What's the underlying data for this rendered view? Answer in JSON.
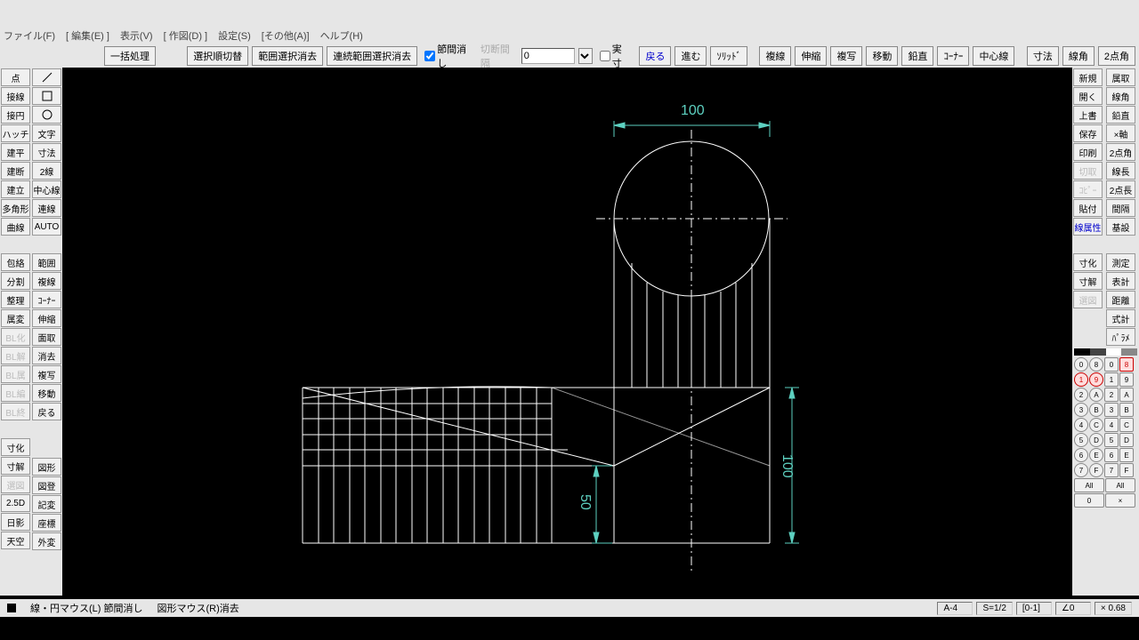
{
  "menu": {
    "file": "ファイル(F)",
    "edit": "[ 編集(E) ]",
    "view": "表示(V)",
    "draw": "[ 作図(D) ]",
    "settings": "設定(S)",
    "other": "[その他(A)]",
    "help": "ヘルプ(H)"
  },
  "toolbar": {
    "batch": "一括処理",
    "sel_order": "選択順切替",
    "range_del": "範囲選択消去",
    "cont_range_del": "連続範囲選択消去",
    "chk1_label": "節間消し",
    "cut_label": "切断間隔",
    "cut_val": "0",
    "chk2_label": "実寸",
    "back": "戻る",
    "fwd": "進む",
    "solid": "ｿﾘｯﾄﾞ",
    "dup_line": "複線",
    "ext": "伸縮",
    "copy": "複写",
    "move": "移動",
    "perp": "鉛直",
    "corner": "ｺｰﾅｰ",
    "center": "中心線",
    "dim": "寸法",
    "angle": "線角",
    "pt2": "2点角"
  },
  "left": {
    "col1": [
      "点",
      "接線",
      "接円",
      "ハッチ",
      "建平",
      "建断",
      "建立",
      "多角形",
      "曲線"
    ],
    "col2": [
      "／",
      "□",
      "○",
      "文字",
      "寸法",
      "2線",
      "中心線",
      "連線",
      "AUTO"
    ],
    "col1b": [
      "包絡",
      "分割",
      "整理",
      "属変",
      "BL化",
      "BL解",
      "BL属",
      "BL編",
      "BL終"
    ],
    "col2b": [
      "範囲",
      "複線",
      "ｺｰﾅｰ",
      "伸縮",
      "面取",
      "消去",
      "複写",
      "移動",
      "戻る"
    ],
    "col1c": [
      "寸化",
      "寸解",
      "選図",
      "2.5D",
      "日影",
      "天空"
    ],
    "col2c": [
      "図形",
      "図登",
      "記変",
      "座標",
      "外変"
    ]
  },
  "right": {
    "col1": [
      "新規",
      "開く",
      "上書",
      "保存",
      "印刷",
      "切取",
      "ｺﾋﾟｰ",
      "貼付",
      "線属性"
    ],
    "col2": [
      "属取",
      "線角",
      "鉛直",
      "×軸",
      "2点角",
      "線長",
      "2点長",
      "間隔",
      "基設"
    ],
    "col1b": [
      "寸化",
      "寸解",
      "選図"
    ],
    "col2b": [
      "測定",
      "表計",
      "距離",
      "式計",
      "ﾊﾟﾗﾒ"
    ],
    "all": "All",
    "zero": "0",
    "x": "×"
  },
  "layer_rows_left": [
    "0",
    "1",
    "2",
    "3",
    "4",
    "5",
    "6",
    "7"
  ],
  "layer_rows_right": [
    "8",
    "9",
    "A",
    "B",
    "C",
    "D",
    "E",
    "F"
  ],
  "status": {
    "msg1": "線・円マウス(L) 節間消し",
    "msg2": "図形マウス(R)消去",
    "paper": "A-4",
    "scale": "S=1/2",
    "layer": "[0-1]",
    "angle": "∠0",
    "zoom": "× 0.68"
  },
  "dims": {
    "top": "100",
    "right": "100",
    "mid": "50"
  }
}
